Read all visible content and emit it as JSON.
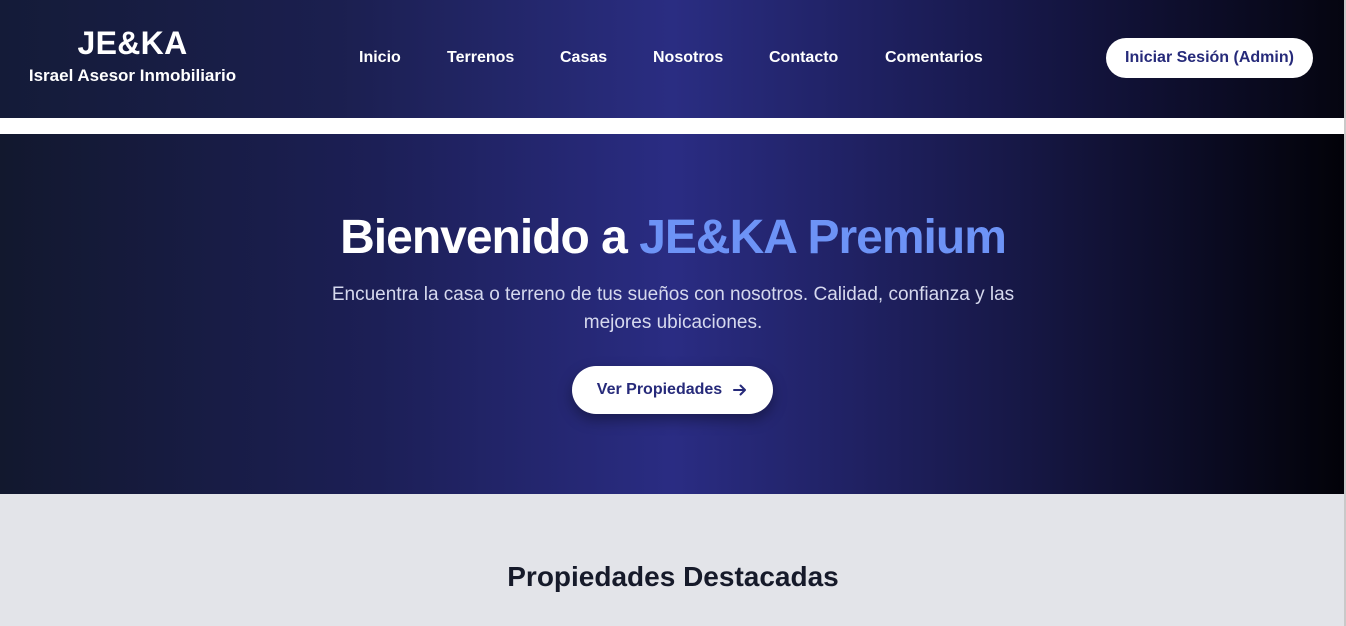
{
  "header": {
    "brand_title": "JE&KA",
    "brand_subtitle": "Israel Asesor Inmobiliario",
    "nav": [
      {
        "label": "Inicio"
      },
      {
        "label": "Terrenos"
      },
      {
        "label": "Casas"
      },
      {
        "label": "Nosotros"
      },
      {
        "label": "Contacto"
      },
      {
        "label": "Comentarios"
      }
    ],
    "login_label": "Iniciar Sesión (Admin)"
  },
  "hero": {
    "title_prefix": "Bienvenido a ",
    "title_accent": "JE&KA Premium",
    "description": "Encuentra la casa o terreno de tus sueños con nosotros. Calidad, confianza y las mejores ubicaciones.",
    "cta_label": "Ver Propiedades",
    "cta_icon": "arrow-right-icon"
  },
  "featured": {
    "title": "Propiedades Destacadas"
  },
  "colors": {
    "accent": "#6d93f6",
    "brand_dark": "#262a7a",
    "hero_mid": "#2a2c83"
  }
}
